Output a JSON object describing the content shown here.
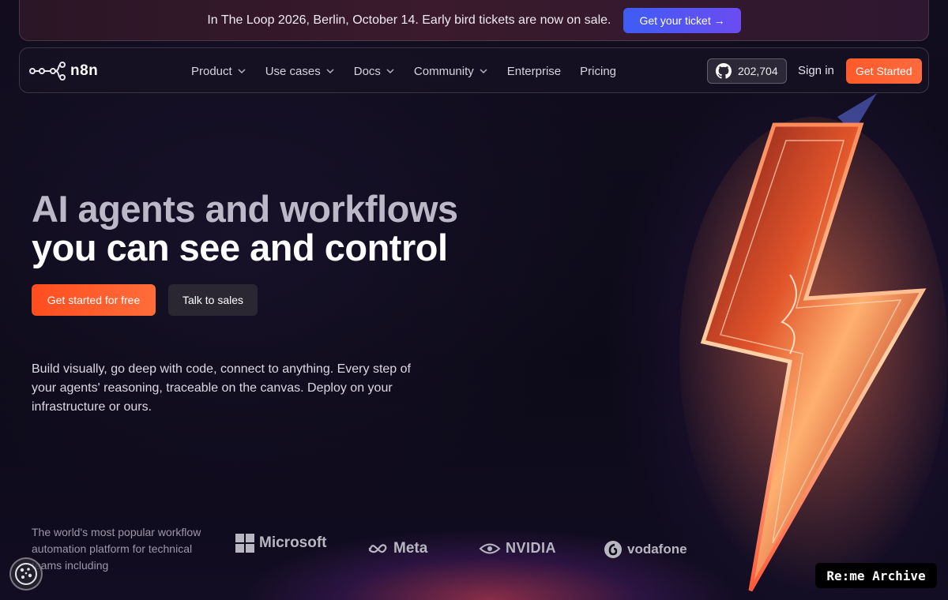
{
  "banner": {
    "text": "In The Loop 2026, Berlin, October 14. Early bird tickets are now on sale.",
    "button_label": "Get your ticket →"
  },
  "nav": {
    "logo_text": "n8n",
    "menu": [
      {
        "label": "Product",
        "has_dropdown": true
      },
      {
        "label": "Use cases",
        "has_dropdown": true
      },
      {
        "label": "Docs",
        "has_dropdown": true
      },
      {
        "label": "Community",
        "has_dropdown": true
      },
      {
        "label": "Enterprise",
        "has_dropdown": false
      },
      {
        "label": "Pricing",
        "has_dropdown": false
      }
    ],
    "github_stars": "202,704",
    "signin_label": "Sign in",
    "get_started_label": "Get Started"
  },
  "hero": {
    "title_line1": "AI agents and workflows",
    "title_line2": "you can see and control",
    "cta_primary": "Get started for free",
    "cta_secondary": "Talk to sales",
    "description": "Build visually, go deep with code, connect to anything. Every step of your agents' reasoning, traceable on the canvas. Deploy on your infrastructure or ours."
  },
  "trust": {
    "text": "The world's most popular workflow automation platform for technical teams including",
    "brands": [
      "Microsoft",
      "Meta",
      "NVIDIA",
      "vodafone"
    ]
  },
  "overlay": {
    "archive_label": "Re:me Archive"
  },
  "colors": {
    "accent_orange": "#ff5a2a",
    "banner_button": "#4f56f2",
    "background": "#0e0b1a"
  }
}
